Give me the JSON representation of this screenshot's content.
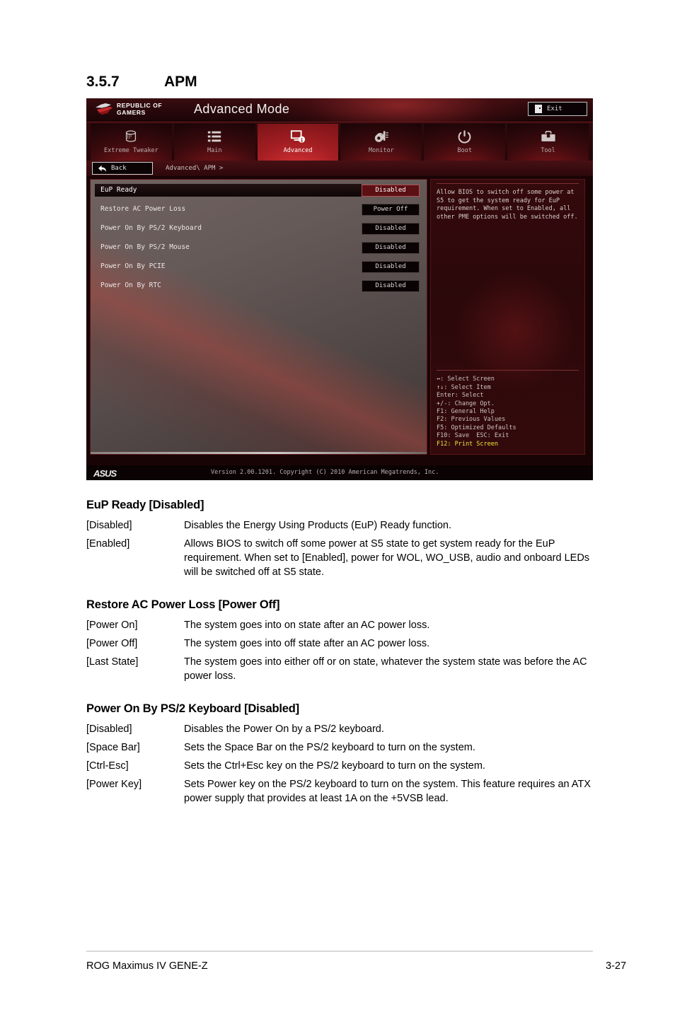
{
  "section": {
    "number": "3.5.7",
    "title": "APM"
  },
  "bios": {
    "brand_line1": "REPUBLIC OF",
    "brand_line2": "GAMERS",
    "mode_title": "Advanced Mode",
    "exit_label": "Exit",
    "back_label": "Back",
    "breadcrumb": "Advanced\\ APM >",
    "tabs": [
      {
        "label": "Extreme Tweaker",
        "icon": "tweaker-icon",
        "active": false
      },
      {
        "label": "Main",
        "icon": "list-icon",
        "active": false
      },
      {
        "label": "Advanced",
        "icon": "monitor-info-icon",
        "active": true
      },
      {
        "label": "Monitor",
        "icon": "thermometer-icon",
        "active": false
      },
      {
        "label": "Boot",
        "icon": "power-icon",
        "active": false
      },
      {
        "label": "Tool",
        "icon": "toolbox-icon",
        "active": false
      }
    ],
    "options": [
      {
        "name": "EuP Ready",
        "value": "Disabled",
        "selected": true
      },
      {
        "name": "Restore AC Power Loss",
        "value": "Power Off",
        "selected": false
      },
      {
        "name": "Power On By PS/2 Keyboard",
        "value": "Disabled",
        "selected": false
      },
      {
        "name": "Power On By PS/2 Mouse",
        "value": "Disabled",
        "selected": false
      },
      {
        "name": "Power On By PCIE",
        "value": "Disabled",
        "selected": false
      },
      {
        "name": "Power On By RTC",
        "value": "Disabled",
        "selected": false
      }
    ],
    "help_text": "Allow BIOS to switch off some power at S5 to get the system ready for EuP requirement. When set to Enabled, all other PME options will be switched off.",
    "legend": [
      {
        "text": "↔: Select Screen",
        "highlight": false
      },
      {
        "text": "↑↓: Select Item",
        "highlight": false
      },
      {
        "text": "Enter: Select",
        "highlight": false
      },
      {
        "text": "+/-: Change Opt.",
        "highlight": false
      },
      {
        "text": "F1: General Help",
        "highlight": false
      },
      {
        "text": "F2: Previous Values",
        "highlight": false
      },
      {
        "text": "F5: Optimized Defaults",
        "highlight": false
      },
      {
        "text": "F10: Save  ESC: Exit",
        "highlight": false
      },
      {
        "text": "F12: Print Screen",
        "highlight": true
      }
    ],
    "vendor_logo": "ASUS",
    "version_text": "Version 2.00.1201. Copyright (C) 2010 American Megatrends, Inc."
  },
  "doc": {
    "sections": [
      {
        "title": "EuP Ready [Disabled]",
        "rows": [
          {
            "key": "[Disabled]",
            "desc": "Disables the Energy Using Products (EuP) Ready function."
          },
          {
            "key": "[Enabled]",
            "desc": "Allows BIOS to switch off some power at S5 state to get system ready for the EuP requirement. When set to [Enabled], power for WOL, WO_USB, audio and onboard LEDs will be switched off at S5 state."
          }
        ]
      },
      {
        "title": "Restore AC Power Loss [Power Off]",
        "rows": [
          {
            "key": "[Power On]",
            "desc": "The system goes into on state after an AC power loss."
          },
          {
            "key": "[Power Off]",
            "desc": "The system goes into off state after an AC power loss."
          },
          {
            "key": "[Last State]",
            "desc": "The system goes into either off or on state, whatever the system state was before the AC power loss."
          }
        ]
      },
      {
        "title": "Power On By PS/2 Keyboard [Disabled]",
        "rows": [
          {
            "key": "[Disabled]",
            "desc": "Disables the Power On by a PS/2 keyboard."
          },
          {
            "key": "[Space Bar]",
            "desc": "Sets the Space Bar on the PS/2 keyboard to turn on the system."
          },
          {
            "key": "[Ctrl-Esc]",
            "desc": "Sets the Ctrl+Esc key on the PS/2 keyboard to turn on the system."
          },
          {
            "key": "[Power Key]",
            "desc": "Sets Power key on the PS/2 keyboard to turn on the system. This feature requires an ATX power supply that provides at least 1A on the +5VSB lead."
          }
        ]
      }
    ]
  },
  "page_footer": {
    "left": "ROG Maximus IV GENE-Z",
    "right": "3-27"
  }
}
